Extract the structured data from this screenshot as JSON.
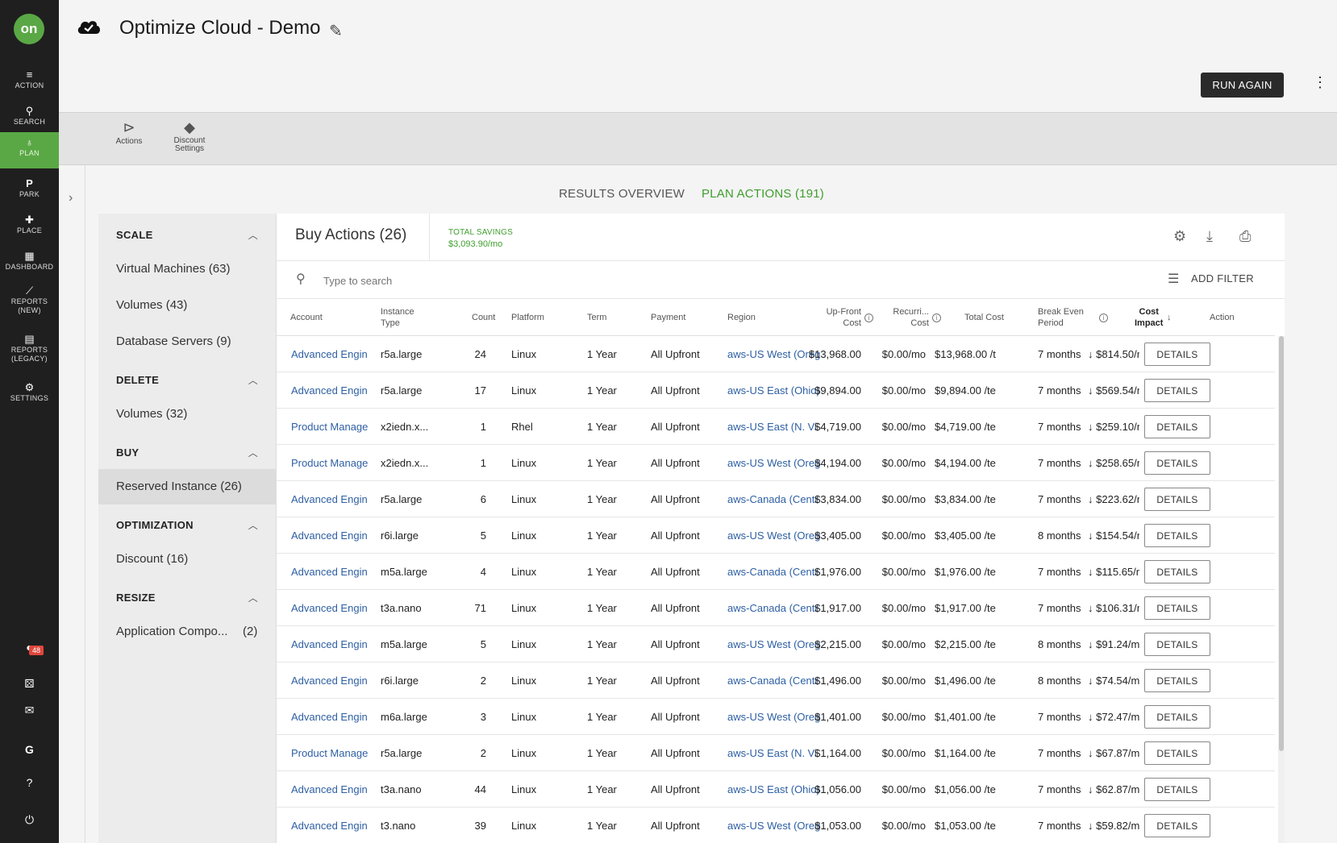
{
  "nav": {
    "logo": "on",
    "items": [
      {
        "label": "ACTION",
        "icon": "action-icon"
      },
      {
        "label": "SEARCH",
        "icon": "search-icon"
      },
      {
        "label": "PLAN",
        "icon": "plan-icon"
      },
      {
        "label": "PARK",
        "icon": "park-icon"
      },
      {
        "label": "PLACE",
        "icon": "place-icon"
      },
      {
        "label": "DASHBOARD",
        "icon": "dashboard-icon"
      },
      {
        "label": "REPORTS",
        "sublabel": "(NEW)",
        "icon": "reports-icon"
      },
      {
        "label": "REPORTS",
        "sublabel": "(LEGACY)",
        "icon": "reports-legacy-icon"
      },
      {
        "label": "SETTINGS",
        "icon": "gear-icon"
      }
    ],
    "notification_count": "48"
  },
  "header": {
    "title": "Optimize Cloud - Demo",
    "run_again": "RUN AGAIN"
  },
  "toolbar": {
    "actions_label": "Actions",
    "discount_label": "Discount",
    "discount_label_2": "Settings"
  },
  "tabs": {
    "overview": "RESULTS OVERVIEW",
    "plan_actions": "PLAN ACTIONS (191)"
  },
  "sidebar": {
    "scale": {
      "title": "SCALE",
      "items": [
        "Virtual Machines (63)",
        "Volumes (43)",
        "Database Servers (9)"
      ]
    },
    "delete": {
      "title": "DELETE",
      "items": [
        "Volumes (32)"
      ]
    },
    "buy": {
      "title": "BUY",
      "items": [
        "Reserved Instance (26)"
      ]
    },
    "optimization": {
      "title": "OPTIMIZATION",
      "items": [
        "Discount (16)"
      ]
    },
    "resize": {
      "title": "RESIZE",
      "items": [
        "Application Compo...",
        "(2)"
      ]
    }
  },
  "panel": {
    "title": "Buy Actions (26)",
    "total_savings_label": "TOTAL SAVINGS",
    "total_savings_value": "$3,093.90/mo",
    "search_placeholder": "Type to search",
    "add_filter": "ADD FILTER"
  },
  "table": {
    "headers": {
      "account": "Account",
      "instance_type": "Instance",
      "instance_type_2": "Type",
      "count": "Count",
      "platform": "Platform",
      "term": "Term",
      "payment": "Payment",
      "region": "Region",
      "upfront": "Up-Front",
      "upfront_2": "Cost",
      "recurring": "Recurri...",
      "recurring_2": "Cost",
      "total_cost": "Total Cost",
      "break_even": "Break Even",
      "break_even_2": "Period",
      "cost_impact": "Cost",
      "cost_impact_2": "Impact",
      "action": "Action"
    },
    "details_label": "DETAILS",
    "rows": [
      {
        "account": "Advanced Engin",
        "type": "r5a.large",
        "count": "24",
        "platform": "Linux",
        "term": "1 Year",
        "payment": "All Upfront",
        "region": "aws-US West (Oreg",
        "upfront": "$13,968.00",
        "recurring": "$0.00/mo",
        "total": "$13,968.00 /t",
        "break_even": "7 months",
        "impact": "$814.50/n"
      },
      {
        "account": "Advanced Engin",
        "type": "r5a.large",
        "count": "17",
        "platform": "Linux",
        "term": "1 Year",
        "payment": "All Upfront",
        "region": "aws-US East (Ohio)",
        "upfront": "$9,894.00",
        "recurring": "$0.00/mo",
        "total": "$9,894.00 /te",
        "break_even": "7 months",
        "impact": "$569.54/n"
      },
      {
        "account": "Product Manage",
        "type": "x2iedn.x...",
        "count": "1",
        "platform": "Rhel",
        "term": "1 Year",
        "payment": "All Upfront",
        "region": "aws-US East (N. Vi",
        "upfront": "$4,719.00",
        "recurring": "$0.00/mo",
        "total": "$4,719.00 /te",
        "break_even": "7 months",
        "impact": "$259.10/n"
      },
      {
        "account": "Product Manage",
        "type": "x2iedn.x...",
        "count": "1",
        "platform": "Linux",
        "term": "1 Year",
        "payment": "All Upfront",
        "region": "aws-US West (Oreg",
        "upfront": "$4,194.00",
        "recurring": "$0.00/mo",
        "total": "$4,194.00 /te",
        "break_even": "7 months",
        "impact": "$258.65/n"
      },
      {
        "account": "Advanced Engin",
        "type": "r5a.large",
        "count": "6",
        "platform": "Linux",
        "term": "1 Year",
        "payment": "All Upfront",
        "region": "aws-Canada (Centr",
        "upfront": "$3,834.00",
        "recurring": "$0.00/mo",
        "total": "$3,834.00 /te",
        "break_even": "7 months",
        "impact": "$223.62/n"
      },
      {
        "account": "Advanced Engin",
        "type": "r6i.large",
        "count": "5",
        "platform": "Linux",
        "term": "1 Year",
        "payment": "All Upfront",
        "region": "aws-US West (Oreg",
        "upfront": "$3,405.00",
        "recurring": "$0.00/mo",
        "total": "$3,405.00 /te",
        "break_even": "8 months",
        "impact": "$154.54/n"
      },
      {
        "account": "Advanced Engin",
        "type": "m5a.large",
        "count": "4",
        "platform": "Linux",
        "term": "1 Year",
        "payment": "All Upfront",
        "region": "aws-Canada (Centr",
        "upfront": "$1,976.00",
        "recurring": "$0.00/mo",
        "total": "$1,976.00 /te",
        "break_even": "7 months",
        "impact": "$115.65/n"
      },
      {
        "account": "Advanced Engin",
        "type": "t3a.nano",
        "count": "71",
        "platform": "Linux",
        "term": "1 Year",
        "payment": "All Upfront",
        "region": "aws-Canada (Centr",
        "upfront": "$1,917.00",
        "recurring": "$0.00/mo",
        "total": "$1,917.00 /te",
        "break_even": "7 months",
        "impact": "$106.31/n"
      },
      {
        "account": "Advanced Engin",
        "type": "m5a.large",
        "count": "5",
        "platform": "Linux",
        "term": "1 Year",
        "payment": "All Upfront",
        "region": "aws-US West (Oreg",
        "upfront": "$2,215.00",
        "recurring": "$0.00/mo",
        "total": "$2,215.00 /te",
        "break_even": "8 months",
        "impact": "$91.24/m"
      },
      {
        "account": "Advanced Engin",
        "type": "r6i.large",
        "count": "2",
        "platform": "Linux",
        "term": "1 Year",
        "payment": "All Upfront",
        "region": "aws-Canada (Centr",
        "upfront": "$1,496.00",
        "recurring": "$0.00/mo",
        "total": "$1,496.00 /te",
        "break_even": "8 months",
        "impact": "$74.54/m"
      },
      {
        "account": "Advanced Engin",
        "type": "m6a.large",
        "count": "3",
        "platform": "Linux",
        "term": "1 Year",
        "payment": "All Upfront",
        "region": "aws-US West (Oreg",
        "upfront": "$1,401.00",
        "recurring": "$0.00/mo",
        "total": "$1,401.00 /te",
        "break_even": "7 months",
        "impact": "$72.47/m"
      },
      {
        "account": "Product Manage",
        "type": "r5a.large",
        "count": "2",
        "platform": "Linux",
        "term": "1 Year",
        "payment": "All Upfront",
        "region": "aws-US East (N. Vi",
        "upfront": "$1,164.00",
        "recurring": "$0.00/mo",
        "total": "$1,164.00 /te",
        "break_even": "7 months",
        "impact": "$67.87/m"
      },
      {
        "account": "Advanced Engin",
        "type": "t3a.nano",
        "count": "44",
        "platform": "Linux",
        "term": "1 Year",
        "payment": "All Upfront",
        "region": "aws-US East (Ohio)",
        "upfront": "$1,056.00",
        "recurring": "$0.00/mo",
        "total": "$1,056.00 /te",
        "break_even": "7 months",
        "impact": "$62.87/m"
      },
      {
        "account": "Advanced Engin",
        "type": "t3.nano",
        "count": "39",
        "platform": "Linux",
        "term": "1 Year",
        "payment": "All Upfront",
        "region": "aws-US West (Oreg",
        "upfront": "$1,053.00",
        "recurring": "$0.00/mo",
        "total": "$1,053.00 /te",
        "break_even": "7 months",
        "impact": "$59.82/m"
      }
    ]
  },
  "colors": {
    "accent": "#5aa845",
    "link": "#2e5fa3",
    "nav_bg": "#1f1f1f"
  }
}
